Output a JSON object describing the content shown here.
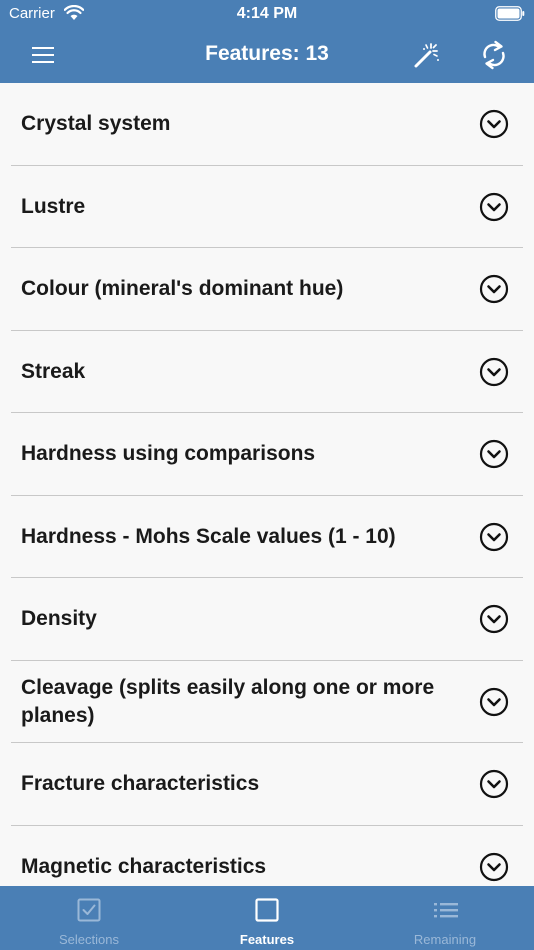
{
  "status_bar": {
    "carrier": "Carrier",
    "time": "4:14 PM"
  },
  "navbar": {
    "title": "Features: 13",
    "left_icon": "hamburger-menu-icon",
    "right_icons": [
      "magic-wand-icon",
      "refresh-icon"
    ]
  },
  "features": [
    {
      "label": "Crystal system"
    },
    {
      "label": "Lustre"
    },
    {
      "label": "Colour (mineral's dominant hue)"
    },
    {
      "label": "Streak"
    },
    {
      "label": "Hardness using comparisons"
    },
    {
      "label": "Hardness - Mohs Scale values (1 - 10)"
    },
    {
      "label": "Density"
    },
    {
      "label": "Cleavage (splits easily along one or more planes)"
    },
    {
      "label": "Fracture characteristics"
    },
    {
      "label": "Magnetic characteristics"
    }
  ],
  "tabbar": {
    "tabs": [
      {
        "label": "Selections",
        "icon": "checkbox-icon",
        "active": false
      },
      {
        "label": "Features",
        "icon": "square-icon",
        "active": true
      },
      {
        "label": "Remaining",
        "icon": "list-icon",
        "active": false
      }
    ]
  },
  "colors": {
    "header_bg": "#4a7fb5",
    "list_bg": "#f8f8f8",
    "tab_inactive": "#9ab8d8",
    "tab_active": "#ffffff"
  }
}
